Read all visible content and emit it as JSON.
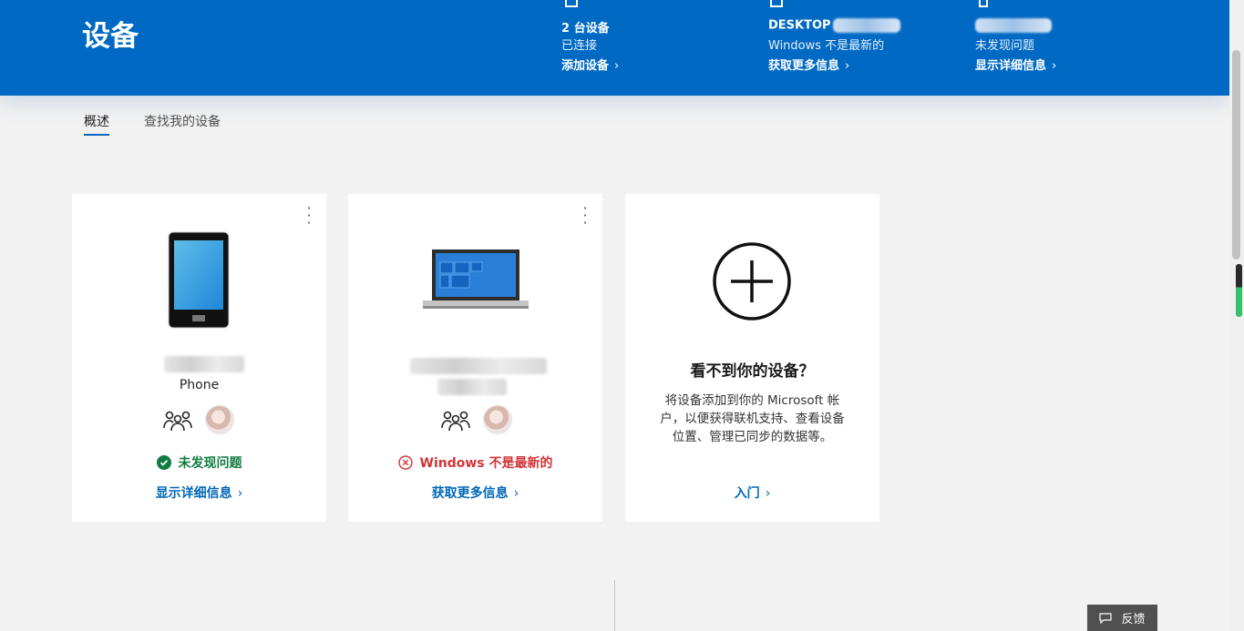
{
  "header": {
    "title": "设备",
    "summary": [
      {
        "line1": "2 台设备",
        "line2": "已连接",
        "link": "添加设备"
      },
      {
        "line1": "DESKTOP",
        "line2": "Windows 不是最新的",
        "link": "获取更多信息"
      },
      {
        "line1": "",
        "line2": "未发现问题",
        "link": "显示详细信息"
      }
    ],
    "chevron": "›"
  },
  "tabs": [
    {
      "label": "概述",
      "active": true
    },
    {
      "label": "查找我的设备",
      "active": false
    }
  ],
  "cards": [
    {
      "device_type": "Phone",
      "status": "未发现问题",
      "link": "显示详细信息"
    },
    {
      "status": "Windows 不是最新的",
      "link": "获取更多信息"
    },
    {
      "title": "看不到你的设备？",
      "description": "将设备添加到你的 Microsoft 帐户，以便获得联机支持、查看设备位置、管理已同步的数据等。",
      "link": "入门"
    }
  ],
  "feedback": {
    "label": "反馈"
  },
  "colors": {
    "header_bg": "#0069c4",
    "link": "#0067b8",
    "ok": "#107c41",
    "error": "#d13438"
  }
}
